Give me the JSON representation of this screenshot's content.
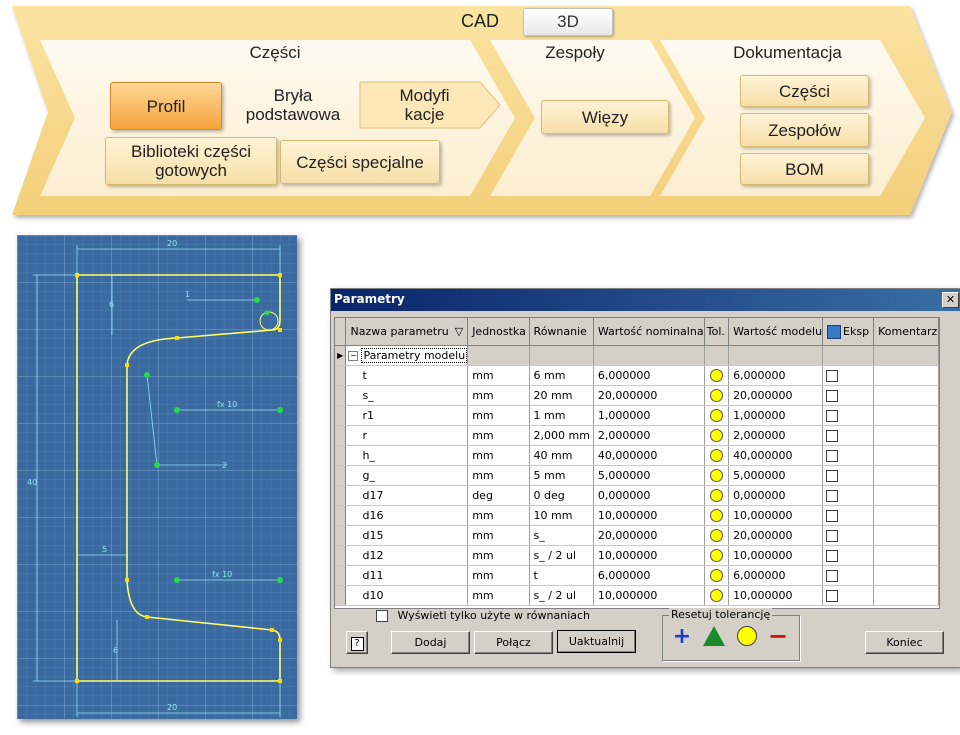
{
  "workflow": {
    "stage_cad": "CAD",
    "stage_3d": "3D",
    "czesci_label": "Części",
    "zespoly_label": "Zespoły",
    "dokumentacja_label": "Dokumentacja",
    "profil": "Profil",
    "bryla_line1": "Bryła",
    "bryla_line2": "podstawowa",
    "modyfikacje_line1": "Modyfi",
    "modyfikacje_line2": "kacje",
    "biblioteki_line1": "Biblioteki części",
    "biblioteki_line2": "gotowych",
    "czesci_specjalne": "Części specjalne",
    "wiezy": "Więzy",
    "dok_czesci": "Części",
    "dok_zespolow": "Zespołów",
    "dok_bom": "BOM"
  },
  "sketch": {
    "dims": {
      "top": "20",
      "height_total": "40",
      "small_h": "6",
      "offset_5": "5",
      "fx10_top": "fx 10",
      "fx10_bot": "fx 10",
      "bottom": "20",
      "left_6": "6",
      "r1": "1",
      "r2": "2"
    }
  },
  "dialog": {
    "title": "Parametry",
    "close_glyph": "✕",
    "columns": {
      "name": "Nazwa parametru",
      "unit": "Jednostka",
      "equation": "Równanie",
      "nominal": "Wartość nominalna",
      "tol": "Tol.",
      "model_value": "Wartość modelu",
      "export": "Eksp",
      "comment": "Komentarz"
    },
    "group_label": "Parametry modelu",
    "rows": [
      {
        "name": "t",
        "unit": "mm",
        "eq": "6 mm",
        "nominal": "6,000000",
        "model": "6,000000"
      },
      {
        "name": "s_",
        "unit": "mm",
        "eq": "20 mm",
        "nominal": "20,000000",
        "model": "20,000000"
      },
      {
        "name": "r1",
        "unit": "mm",
        "eq": "1 mm",
        "nominal": "1,000000",
        "model": "1,000000"
      },
      {
        "name": "r",
        "unit": "mm",
        "eq": "2,000 mm",
        "nominal": "2,000000",
        "model": "2,000000"
      },
      {
        "name": "h_",
        "unit": "mm",
        "eq": "40 mm",
        "nominal": "40,000000",
        "model": "40,000000"
      },
      {
        "name": "g_",
        "unit": "mm",
        "eq": "5 mm",
        "nominal": "5,000000",
        "model": "5,000000"
      },
      {
        "name": "d17",
        "unit": "deg",
        "eq": "0 deg",
        "nominal": "0,000000",
        "model": "0,000000"
      },
      {
        "name": "d16",
        "unit": "mm",
        "eq": "10 mm",
        "nominal": "10,000000",
        "model": "10,000000"
      },
      {
        "name": "d15",
        "unit": "mm",
        "eq": "s_",
        "nominal": "20,000000",
        "model": "20,000000"
      },
      {
        "name": "d12",
        "unit": "mm",
        "eq": "s_ / 2 ul",
        "nominal": "10,000000",
        "model": "10,000000"
      },
      {
        "name": "d11",
        "unit": "mm",
        "eq": "t",
        "nominal": "6,000000",
        "model": "6,000000"
      },
      {
        "name": "d10",
        "unit": "mm",
        "eq": "s_ / 2 ul",
        "nominal": "10,000000",
        "model": "10,000000"
      }
    ],
    "show_used_label": "Wyświetl tylko użyte w równaniach",
    "reset_tol_label": "Resetuj tolerancję",
    "help_glyph": "?",
    "buttons": {
      "add": "Dodaj",
      "link": "Połącz",
      "update": "Uaktualnij",
      "close": "Koniec"
    },
    "tol_glyphs": {
      "plus": "+",
      "minus": "−"
    }
  },
  "colors": {
    "banner": "#f7d98c",
    "banner_light": "#fdf2d4",
    "accent_orange": "#f6a33b",
    "cad_bg": "#3a6aa0",
    "sketch_line": "#ffff66",
    "titlebar": "#0a246a",
    "tol_yellow": "#ffff00"
  }
}
